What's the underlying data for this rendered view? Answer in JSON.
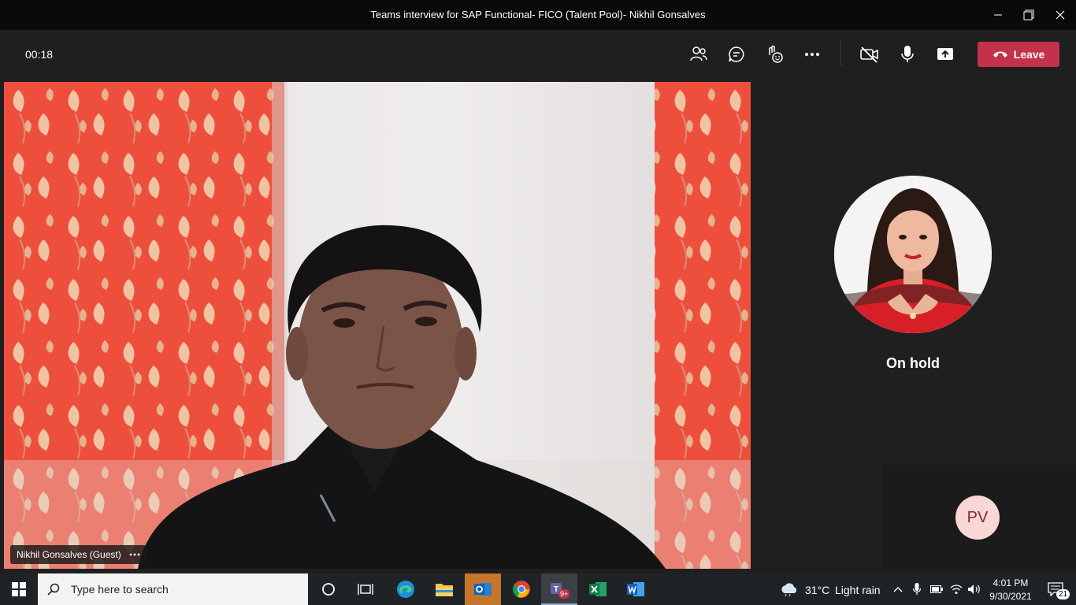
{
  "window": {
    "title": "Teams interview for SAP Functional- FICO (Talent Pool)- Nikhil Gonsalves"
  },
  "call": {
    "timer": "00:18",
    "leave_label": "Leave"
  },
  "main_video": {
    "participant_label": "Nikhil Gonsalves (Guest)"
  },
  "side": {
    "status": "On hold",
    "pv_initials": "PV"
  },
  "taskbar": {
    "search_placeholder": "Type here to search",
    "teams_badge": "9+",
    "weather_temp": "31°C",
    "weather_text": "Light rain",
    "time": "4:01 PM",
    "date": "9/30/2021",
    "notifications": "21"
  },
  "colors": {
    "leave": "#c4314b",
    "accent": "#6264a7",
    "pv_avatar": "#f8d7d5"
  },
  "icons": [
    "minimize-icon",
    "restore-icon",
    "close-icon",
    "people-icon",
    "chat-icon",
    "reactions-icon",
    "more-icon",
    "camera-off-icon",
    "mic-icon",
    "share-icon",
    "hangup-icon",
    "windows-start-icon",
    "search-icon",
    "cortana-icon",
    "task-view-icon",
    "edge-icon",
    "file-explorer-icon",
    "outlook-icon",
    "chrome-icon",
    "teams-icon",
    "excel-icon",
    "word-icon",
    "weather-icon",
    "chevron-up-icon",
    "mic-tray-icon",
    "battery-icon",
    "wifi-icon",
    "volume-icon",
    "notification-icon"
  ]
}
